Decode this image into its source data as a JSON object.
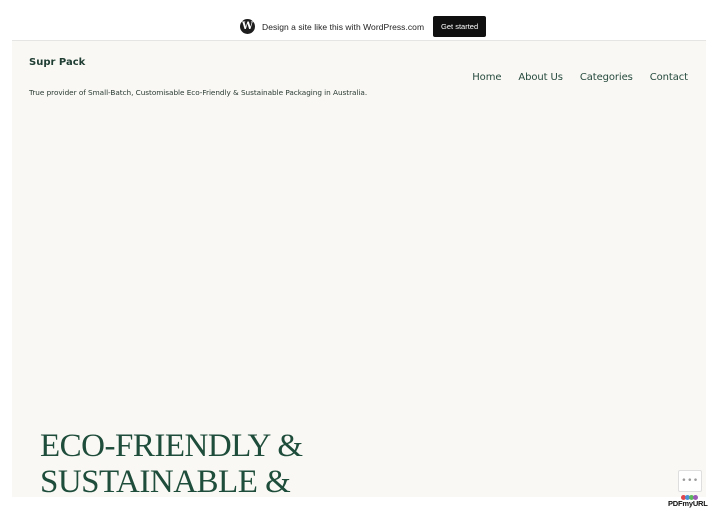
{
  "wordpress_bar": {
    "logo_glyph": "W",
    "logo_icon": "wordpress-logo-icon",
    "promo_text": "Design a site like this with WordPress.com",
    "cta_label": "Get started"
  },
  "header": {
    "site_title": "Supr Pack",
    "tagline": "True provider of Small-Batch, Customisable Eco-Friendly & Sustainable Packaging in Australia."
  },
  "nav": {
    "items": [
      {
        "label": "Home"
      },
      {
        "label": "About Us"
      },
      {
        "label": "Categories"
      },
      {
        "label": "Contact"
      }
    ]
  },
  "hero": {
    "line1": "ECO-FRIENDLY &",
    "line2": "SUSTAINABLE &"
  },
  "floating": {
    "more_label": "•••",
    "more_icon": "ellipsis-icon"
  },
  "watermark": {
    "text": "PDFmyURL",
    "dot_colors": [
      "#e0474c",
      "#4a90d9",
      "#5cb85c",
      "#9b59b6"
    ]
  },
  "colors": {
    "page_background": "#f9f8f4",
    "accent_green": "#1f4d3b",
    "button_dark": "#101010"
  }
}
